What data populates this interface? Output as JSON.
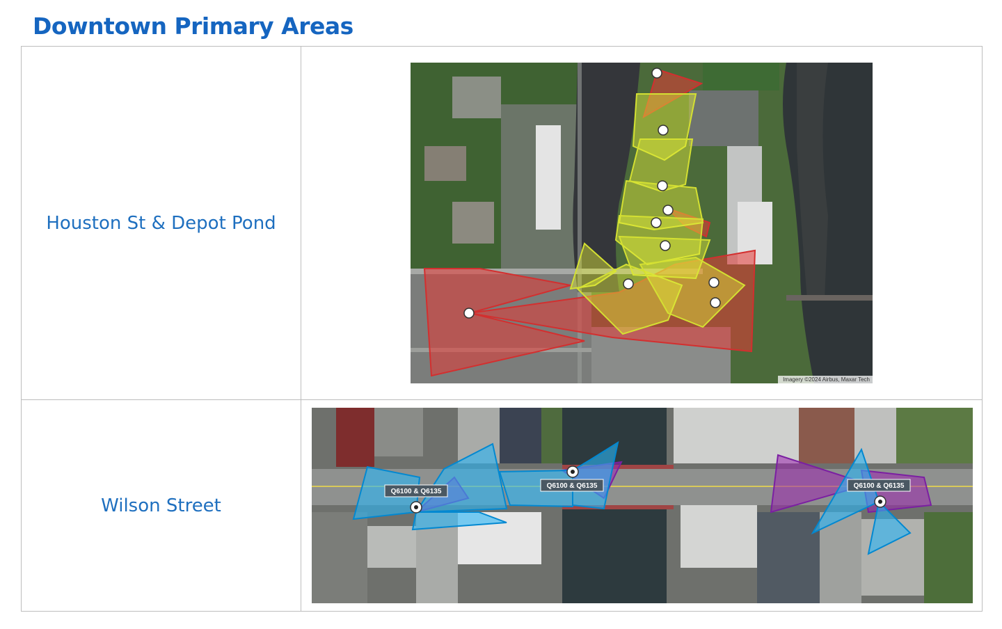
{
  "title": "Downtown Primary Areas",
  "areas": [
    {
      "name": "Houston St & Depot Pond",
      "map": {
        "attribution": "Imagery ©2024 Airbus, Maxar Tech"
      }
    },
    {
      "name": "Wilson Street",
      "map": {
        "camera_labels": [
          "Q6100 & Q6135",
          "Q6100 & Q6135",
          "Q6100 & Q6135"
        ]
      }
    }
  ],
  "colors": {
    "title": "#1565c0",
    "label": "#1e6fbf",
    "coverage_red": "#d32f2f",
    "coverage_yellow": "#d4e032",
    "coverage_blue": "#29b6f6",
    "coverage_purple": "#8e24aa"
  }
}
